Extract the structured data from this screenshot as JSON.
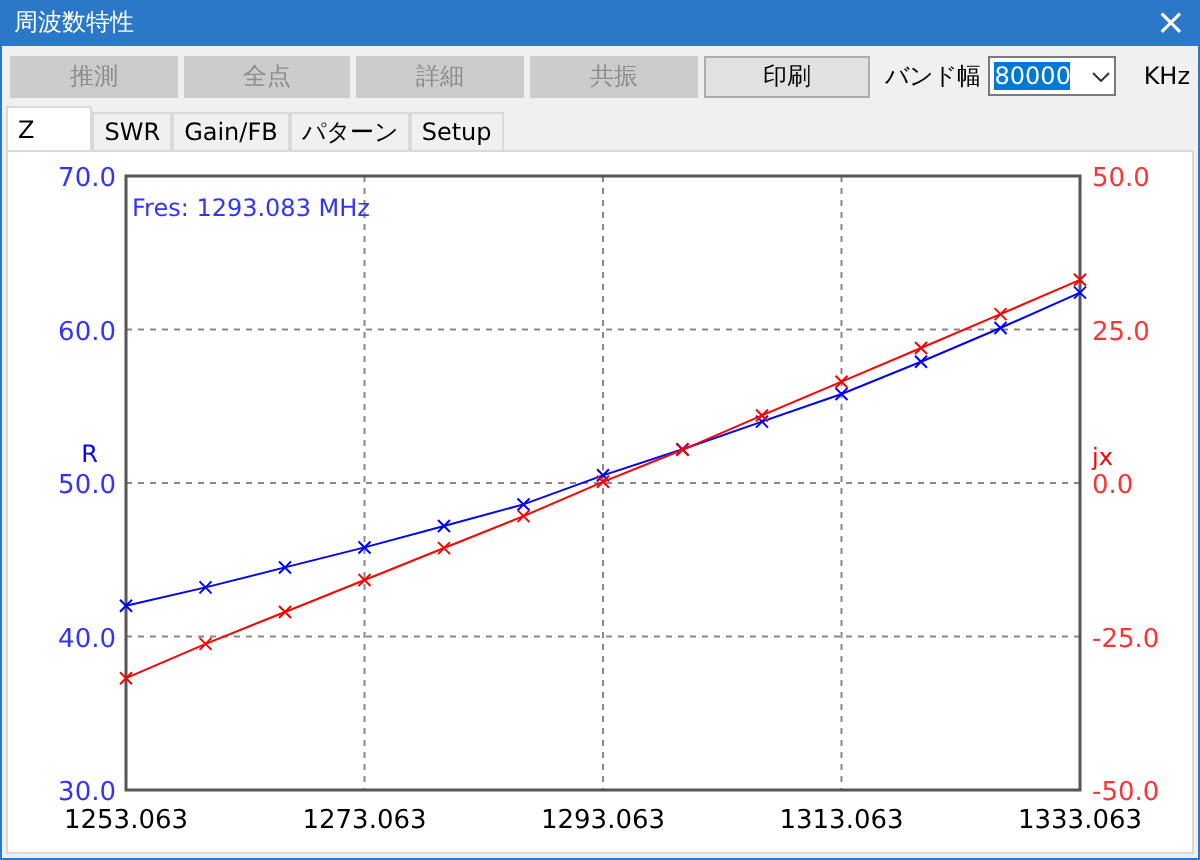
{
  "window": {
    "title": "周波数特性",
    "close": "×"
  },
  "toolbar": {
    "buttons": [
      {
        "label": "推測",
        "disabled": true
      },
      {
        "label": "全点",
        "disabled": true
      },
      {
        "label": "詳細",
        "disabled": true
      },
      {
        "label": "共振",
        "disabled": true
      },
      {
        "label": "印刷",
        "disabled": false
      }
    ],
    "band": {
      "label": "バンド幅",
      "value": "80000",
      "highlighted": true,
      "unit": "KHz"
    }
  },
  "tabs": [
    {
      "label": "Z",
      "selected": true
    },
    {
      "label": "SWR",
      "selected": false
    },
    {
      "label": "Gain/FB",
      "selected": false
    },
    {
      "label": "パターン",
      "selected": false
    },
    {
      "label": "Setup",
      "selected": false
    }
  ],
  "chart": {
    "annotation": "Fres: 1293.083 MHz",
    "chart_data": {
      "type": "line",
      "grid": true,
      "x": [
        1253.063,
        1259.73,
        1266.396,
        1273.063,
        1279.73,
        1286.396,
        1293.063,
        1299.73,
        1306.396,
        1313.063,
        1319.73,
        1326.396,
        1333.063
      ],
      "xlim": [
        1253.063,
        1333.063
      ],
      "xticks": [
        {
          "value": 1253.063,
          "label": "1253.063"
        },
        {
          "value": 1273.063,
          "label": "1273.063"
        },
        {
          "value": 1293.063,
          "label": "1293.063"
        },
        {
          "value": 1313.063,
          "label": "1313.063"
        },
        {
          "value": 1333.063,
          "label": "1333.063"
        }
      ],
      "ylim": [
        30,
        70
      ],
      "yticks": [
        {
          "value": 30,
          "label": "30.0"
        },
        {
          "value": 40,
          "label": "40.0"
        },
        {
          "value": 50,
          "label": "50.0"
        },
        {
          "value": 60,
          "label": "60.0"
        },
        {
          "value": 70,
          "label": "70.0"
        }
      ],
      "y2lim": [
        -50,
        50
      ],
      "y2ticks": [
        {
          "value": -50,
          "label": "-50.0"
        },
        {
          "value": -25,
          "label": "-25.0"
        },
        {
          "value": 0,
          "label": "0.0"
        },
        {
          "value": 25,
          "label": "25.0"
        },
        {
          "value": 50,
          "label": "50.0"
        }
      ],
      "series": [
        {
          "name": "R",
          "color": "#0000ff",
          "marker": "x",
          "values": [
            42.0,
            43.2,
            44.5,
            45.8,
            47.2,
            48.6,
            50.5,
            52.2,
            54.0,
            55.8,
            57.9,
            60.1,
            62.4
          ]
        },
        {
          "name": "jx",
          "color": "#ff0000",
          "axis": "y2",
          "marker": "x",
          "values": [
            -31.8,
            -26.2,
            -21.0,
            -15.8,
            -10.6,
            -5.4,
            0.2,
            5.4,
            11.0,
            16.5,
            22.0,
            27.5,
            33.1
          ]
        }
      ]
    }
  }
}
